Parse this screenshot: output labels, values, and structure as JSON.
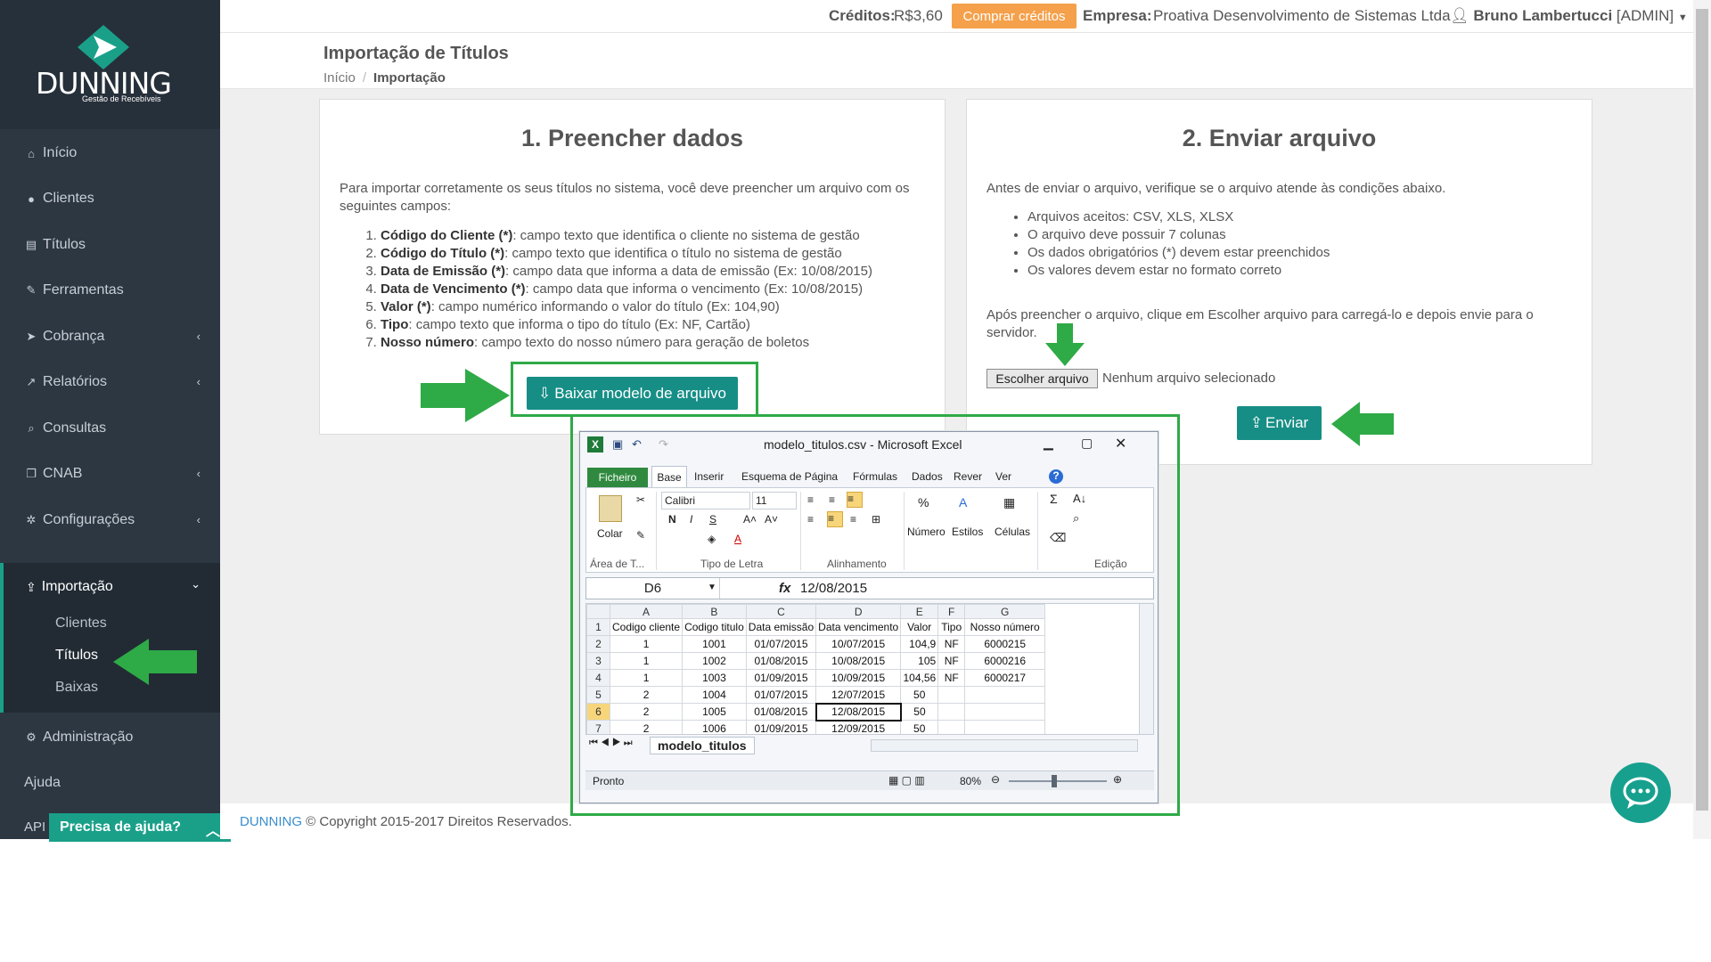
{
  "brand": {
    "name": "DUNNING",
    "subtitle": "Gestão de Recebíveis"
  },
  "sidebar": {
    "items": [
      {
        "label": "Início",
        "icon": "home-icon"
      },
      {
        "label": "Clientes",
        "icon": "user-icon"
      },
      {
        "label": "Títulos",
        "icon": "file-icon"
      },
      {
        "label": "Ferramentas",
        "icon": "wrench-icon"
      },
      {
        "label": "Cobrança",
        "icon": "send-icon"
      },
      {
        "label": "Relatórios",
        "icon": "chart-icon"
      },
      {
        "label": "Consultas",
        "icon": "search-icon"
      },
      {
        "label": "CNAB",
        "icon": "copy-icon"
      },
      {
        "label": "Configurações",
        "icon": "gear-icon"
      }
    ],
    "import_group": {
      "label": "Importação",
      "subitems": [
        "Clientes",
        "Títulos",
        "Baixas"
      ]
    },
    "admin_label": "Administração",
    "help_label": "Ajuda",
    "api_label": "API",
    "help_bar_label": "Precisa de ajuda?"
  },
  "topbar": {
    "credits_label": "Créditos:",
    "credits_value": "R$3,60",
    "buy_label": "Comprar créditos",
    "company_label": "Empresa:",
    "company_value": "Proativa Desenvolvimento de Sistemas Ltda",
    "user_name": "Bruno Lambertucci",
    "user_role": "[ADMIN]"
  },
  "page": {
    "title": "Importação de Títulos",
    "breadcrumb": [
      "Início",
      "Importação"
    ]
  },
  "panel1": {
    "heading": "1. Preencher dados",
    "intro": "Para importar corretamente os seus títulos no sistema, você deve preencher um arquivo com os seguintes campos:",
    "fields": [
      {
        "name": "Código do Cliente (*)",
        "desc": ": campo texto que identifica o cliente no sistema de gestão"
      },
      {
        "name": "Código do Título (*)",
        "desc": ": campo texto que identifica o título no sistema de gestão"
      },
      {
        "name": "Data de Emissão (*)",
        "desc": ": campo data que informa a data de emissão (Ex: 10/08/2015)"
      },
      {
        "name": "Data de Vencimento (*)",
        "desc": ": campo data que informa o vencimento (Ex: 10/08/2015)"
      },
      {
        "name": "Valor (*)",
        "desc": ": campo numérico informando o valor do título (Ex: 104,90)"
      },
      {
        "name": "Tipo",
        "desc": ": campo texto que informa o tipo do título (Ex: NF, Cartão)"
      },
      {
        "name": "Nosso número",
        "desc": ": campo texto do nosso número para geração de boletos"
      }
    ],
    "download_label": "Baixar modelo de arquivo"
  },
  "panel2": {
    "heading": "2. Enviar arquivo",
    "intro": "Antes de enviar o arquivo, verifique se o arquivo atende às condições abaixo.",
    "conditions": [
      "Arquivos aceitos: CSV, XLS, XLSX",
      "O arquivo deve possuir 7 colunas",
      "Os dados obrigatórios (*) devem estar preenchidos",
      "Os valores devem estar no formato correto"
    ],
    "after_text": "Após preencher o arquivo, clique em Escolher arquivo para carregá-lo e depois envie para o servidor.",
    "file_button": "Escolher arquivo",
    "file_none": "Nenhum arquivo selecionado",
    "send_label": "Enviar"
  },
  "excel": {
    "title": "modelo_titulos.csv  -  Microsoft Excel",
    "tabs": [
      "Ficheiro",
      "Base",
      "Inserir",
      "Esquema de Página",
      "Fórmulas",
      "Dados",
      "Rever",
      "Ver"
    ],
    "ribbon": {
      "paste": "Colar",
      "font_name": "Calibri",
      "font_size": "11",
      "number": "Número",
      "styles": "Estilos",
      "cells": "Células",
      "groups": [
        "Área de T...",
        "Tipo de Letra",
        "Alinhamento",
        "Edição"
      ]
    },
    "name_box": "D6",
    "formula_value": "12/08/2015",
    "columns": [
      "A",
      "B",
      "C",
      "D",
      "E",
      "F",
      "G"
    ],
    "rows": [
      [
        "Codigo cliente",
        "Codigo titulo",
        "Data emissão",
        "Data vencimento",
        "Valor",
        "Tipo",
        "Nosso número"
      ],
      [
        "1",
        "1001",
        "01/07/2015",
        "10/07/2015",
        "104,9",
        "NF",
        "6000215"
      ],
      [
        "1",
        "1002",
        "01/08/2015",
        "10/08/2015",
        "105",
        "NF",
        "6000216"
      ],
      [
        "1",
        "1003",
        "01/09/2015",
        "10/09/2015",
        "104,56",
        "NF",
        "6000217"
      ],
      [
        "2",
        "1004",
        "01/07/2015",
        "12/07/2015",
        "50",
        "",
        ""
      ],
      [
        "2",
        "1005",
        "01/08/2015",
        "12/08/2015",
        "50",
        "",
        ""
      ],
      [
        "2",
        "1006",
        "01/09/2015",
        "12/09/2015",
        "50",
        "",
        ""
      ]
    ],
    "sheet_tab": "modelo_titulos",
    "status": "Pronto",
    "zoom": "80%"
  },
  "footer": {
    "brand": "DUNNING",
    "text": " © Copyright 2015-2017 Direitos Reservados."
  },
  "colors": {
    "accent": "#168e86",
    "sidebar": "#2c3742",
    "buy": "#f5a04a",
    "guide": "#2eaa47"
  }
}
